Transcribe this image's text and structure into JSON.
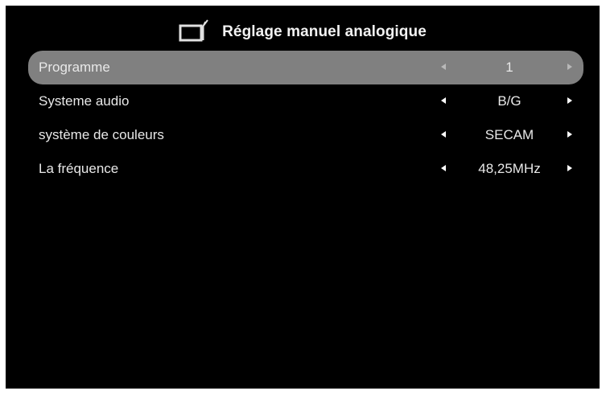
{
  "header": {
    "title": "Réglage manuel analogique",
    "icon": "tv-antenna-icon"
  },
  "menu": {
    "items": [
      {
        "label": "Programme",
        "value": "1",
        "selected": true
      },
      {
        "label": "Systeme audio",
        "value": "B/G",
        "selected": false
      },
      {
        "label": "système de couleurs",
        "value": "SECAM",
        "selected": false
      },
      {
        "label": "La fréquence",
        "value": "48,25MHz",
        "selected": false
      }
    ]
  },
  "colors": {
    "background": "#000000",
    "selected_row": "#808080",
    "text": "#e8e8e8"
  }
}
